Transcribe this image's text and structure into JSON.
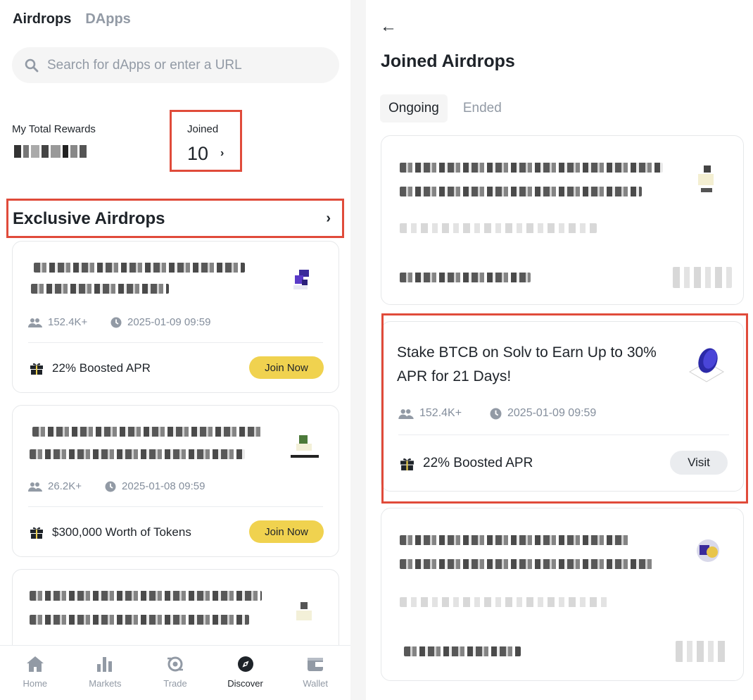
{
  "left": {
    "tabs": [
      {
        "label": "Airdrops"
      },
      {
        "label": "DApps"
      }
    ],
    "search": {
      "placeholder": "Search for dApps or enter a URL"
    },
    "rewards": {
      "label": "My Total Rewards"
    },
    "joined": {
      "label": "Joined",
      "count": "10",
      "chevron": "›"
    },
    "exclusive": {
      "title": "Exclusive Airdrops",
      "chevron": "›"
    },
    "cards": [
      {
        "participants": "152.4K+",
        "date": "2025-01-09 09:59",
        "reward": "22% Boosted APR",
        "button": "Join Now"
      },
      {
        "participants": "26.2K+",
        "date": "2025-01-08 09:59",
        "reward": "$300,000 Worth of Tokens",
        "button": "Join Now"
      }
    ],
    "nav": [
      {
        "label": "Home",
        "icon": "home-icon"
      },
      {
        "label": "Markets",
        "icon": "markets-icon"
      },
      {
        "label": "Trade",
        "icon": "trade-icon"
      },
      {
        "label": "Discover",
        "icon": "discover-icon"
      },
      {
        "label": "Wallet",
        "icon": "wallet-icon"
      }
    ]
  },
  "right": {
    "back": "←",
    "title": "Joined Airdrops",
    "tabs": [
      {
        "label": "Ongoing"
      },
      {
        "label": "Ended"
      }
    ],
    "featured": {
      "title": "Stake BTCB on Solv to Earn Up to 30% APR for 21 Days!",
      "participants": "152.4K+",
      "date": "2025-01-09 09:59",
      "reward": "22% Boosted APR",
      "button": "Visit"
    }
  },
  "colors": {
    "accent_yellow": "#f0d24f",
    "highlight_red": "#e04b3a",
    "muted_text": "#848e9c"
  }
}
